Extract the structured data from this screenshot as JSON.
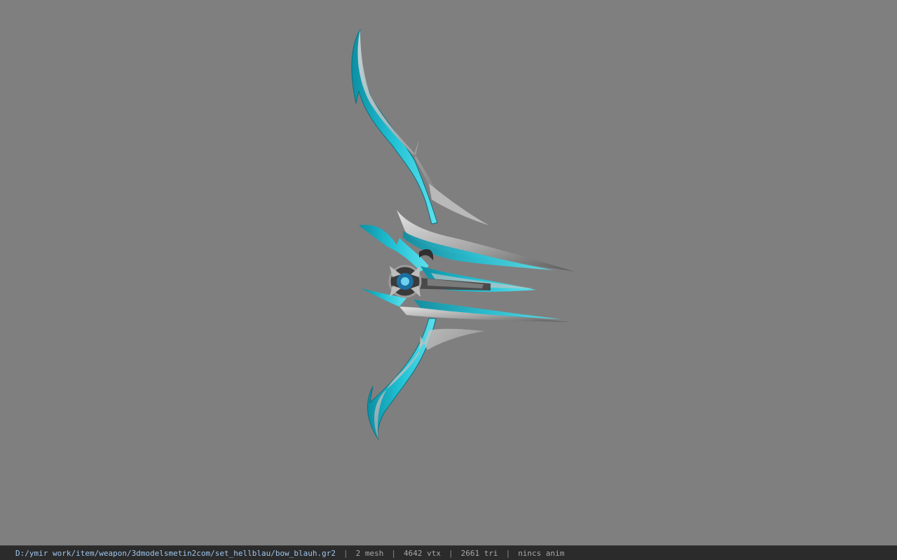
{
  "viewport": {
    "background": "#7f7f7f",
    "model_name": "bow_blauh.gr2"
  },
  "model_colors": {
    "accent": "#17b3c7",
    "accent_light": "#4fd6e3",
    "metal_light": "#c7c7c7",
    "metal_dark": "#3d3d3d"
  },
  "status": {
    "file_path": "D:/ymir work/item/weapon/3dmodelsmetin2com/set_hellblau/bow_blauh.gr2",
    "separator": "|",
    "mesh": "2 mesh",
    "vertices": "4642 vtx",
    "triangles": "2661 tri",
    "anim": "nincs anim"
  }
}
